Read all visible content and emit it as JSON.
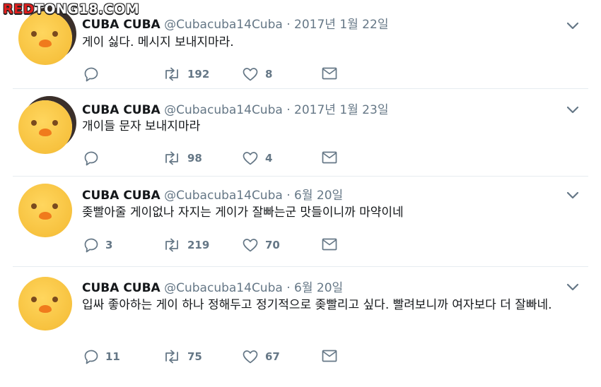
{
  "watermark": {
    "red": "RED",
    "white": "TONG18.COM"
  },
  "tweets": [
    {
      "name": "CUBA CUBA",
      "handle": "@Cubacuba14Cuba",
      "dot": "·",
      "date": "2017년 1월 22일",
      "text": "게이 싫다. 메시지 보내지마라.",
      "replies": "",
      "retweets": "192",
      "likes": "8"
    },
    {
      "name": "CUBA CUBA",
      "handle": "@Cubacuba14Cuba",
      "dot": "·",
      "date": "2017년 1월 23일",
      "text": "개이들 문자 보내지마라",
      "replies": "",
      "retweets": "98",
      "likes": "4"
    },
    {
      "name": "CUBA CUBA",
      "handle": "@Cubacuba14Cuba",
      "dot": "·",
      "date": "6월 20일",
      "text": "좆빨아줄 게이없나 자지는 게이가 잘빠는군 맛들이니까 마약이네",
      "replies": "3",
      "retweets": "219",
      "likes": "70"
    },
    {
      "name": "CUBA CUBA",
      "handle": "@Cubacuba14Cuba",
      "dot": "·",
      "date": "6월 20일",
      "text": "입싸 좋아하는 게이 하나 정해두고 정기적으로 좆빨리고 싶다. 빨려보니까 여자보다 더 잘빠네.",
      "replies": "11",
      "retweets": "75",
      "likes": "67"
    }
  ],
  "icons": {
    "reply": "reply-icon",
    "retweet": "retweet-icon",
    "like": "heart-icon",
    "dm": "envelope-icon",
    "more": "chevron-down-icon"
  },
  "colors": {
    "text": "#14171a",
    "muted": "#657786",
    "divider": "#e6ecf0",
    "watermark_red": "#e0201f"
  }
}
